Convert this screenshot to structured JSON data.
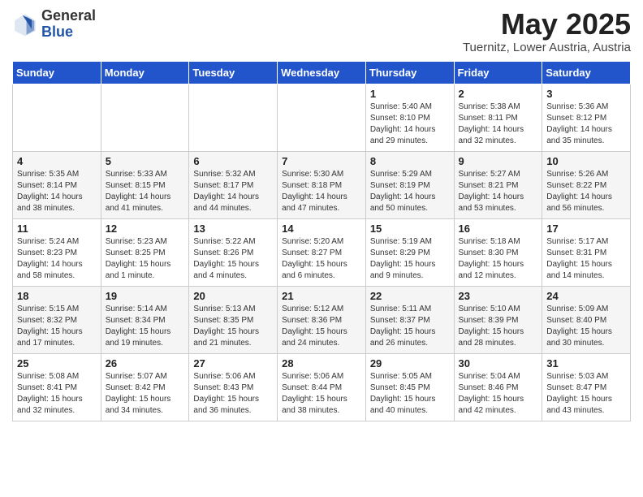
{
  "logo": {
    "general": "General",
    "blue": "Blue"
  },
  "title": "May 2025",
  "subtitle": "Tuernitz, Lower Austria, Austria",
  "days_header": [
    "Sunday",
    "Monday",
    "Tuesday",
    "Wednesday",
    "Thursday",
    "Friday",
    "Saturday"
  ],
  "weeks": [
    [
      {
        "num": "",
        "info": ""
      },
      {
        "num": "",
        "info": ""
      },
      {
        "num": "",
        "info": ""
      },
      {
        "num": "",
        "info": ""
      },
      {
        "num": "1",
        "info": "Sunrise: 5:40 AM\nSunset: 8:10 PM\nDaylight: 14 hours\nand 29 minutes."
      },
      {
        "num": "2",
        "info": "Sunrise: 5:38 AM\nSunset: 8:11 PM\nDaylight: 14 hours\nand 32 minutes."
      },
      {
        "num": "3",
        "info": "Sunrise: 5:36 AM\nSunset: 8:12 PM\nDaylight: 14 hours\nand 35 minutes."
      }
    ],
    [
      {
        "num": "4",
        "info": "Sunrise: 5:35 AM\nSunset: 8:14 PM\nDaylight: 14 hours\nand 38 minutes."
      },
      {
        "num": "5",
        "info": "Sunrise: 5:33 AM\nSunset: 8:15 PM\nDaylight: 14 hours\nand 41 minutes."
      },
      {
        "num": "6",
        "info": "Sunrise: 5:32 AM\nSunset: 8:17 PM\nDaylight: 14 hours\nand 44 minutes."
      },
      {
        "num": "7",
        "info": "Sunrise: 5:30 AM\nSunset: 8:18 PM\nDaylight: 14 hours\nand 47 minutes."
      },
      {
        "num": "8",
        "info": "Sunrise: 5:29 AM\nSunset: 8:19 PM\nDaylight: 14 hours\nand 50 minutes."
      },
      {
        "num": "9",
        "info": "Sunrise: 5:27 AM\nSunset: 8:21 PM\nDaylight: 14 hours\nand 53 minutes."
      },
      {
        "num": "10",
        "info": "Sunrise: 5:26 AM\nSunset: 8:22 PM\nDaylight: 14 hours\nand 56 minutes."
      }
    ],
    [
      {
        "num": "11",
        "info": "Sunrise: 5:24 AM\nSunset: 8:23 PM\nDaylight: 14 hours\nand 58 minutes."
      },
      {
        "num": "12",
        "info": "Sunrise: 5:23 AM\nSunset: 8:25 PM\nDaylight: 15 hours\nand 1 minute."
      },
      {
        "num": "13",
        "info": "Sunrise: 5:22 AM\nSunset: 8:26 PM\nDaylight: 15 hours\nand 4 minutes."
      },
      {
        "num": "14",
        "info": "Sunrise: 5:20 AM\nSunset: 8:27 PM\nDaylight: 15 hours\nand 6 minutes."
      },
      {
        "num": "15",
        "info": "Sunrise: 5:19 AM\nSunset: 8:29 PM\nDaylight: 15 hours\nand 9 minutes."
      },
      {
        "num": "16",
        "info": "Sunrise: 5:18 AM\nSunset: 8:30 PM\nDaylight: 15 hours\nand 12 minutes."
      },
      {
        "num": "17",
        "info": "Sunrise: 5:17 AM\nSunset: 8:31 PM\nDaylight: 15 hours\nand 14 minutes."
      }
    ],
    [
      {
        "num": "18",
        "info": "Sunrise: 5:15 AM\nSunset: 8:32 PM\nDaylight: 15 hours\nand 17 minutes."
      },
      {
        "num": "19",
        "info": "Sunrise: 5:14 AM\nSunset: 8:34 PM\nDaylight: 15 hours\nand 19 minutes."
      },
      {
        "num": "20",
        "info": "Sunrise: 5:13 AM\nSunset: 8:35 PM\nDaylight: 15 hours\nand 21 minutes."
      },
      {
        "num": "21",
        "info": "Sunrise: 5:12 AM\nSunset: 8:36 PM\nDaylight: 15 hours\nand 24 minutes."
      },
      {
        "num": "22",
        "info": "Sunrise: 5:11 AM\nSunset: 8:37 PM\nDaylight: 15 hours\nand 26 minutes."
      },
      {
        "num": "23",
        "info": "Sunrise: 5:10 AM\nSunset: 8:39 PM\nDaylight: 15 hours\nand 28 minutes."
      },
      {
        "num": "24",
        "info": "Sunrise: 5:09 AM\nSunset: 8:40 PM\nDaylight: 15 hours\nand 30 minutes."
      }
    ],
    [
      {
        "num": "25",
        "info": "Sunrise: 5:08 AM\nSunset: 8:41 PM\nDaylight: 15 hours\nand 32 minutes."
      },
      {
        "num": "26",
        "info": "Sunrise: 5:07 AM\nSunset: 8:42 PM\nDaylight: 15 hours\nand 34 minutes."
      },
      {
        "num": "27",
        "info": "Sunrise: 5:06 AM\nSunset: 8:43 PM\nDaylight: 15 hours\nand 36 minutes."
      },
      {
        "num": "28",
        "info": "Sunrise: 5:06 AM\nSunset: 8:44 PM\nDaylight: 15 hours\nand 38 minutes."
      },
      {
        "num": "29",
        "info": "Sunrise: 5:05 AM\nSunset: 8:45 PM\nDaylight: 15 hours\nand 40 minutes."
      },
      {
        "num": "30",
        "info": "Sunrise: 5:04 AM\nSunset: 8:46 PM\nDaylight: 15 hours\nand 42 minutes."
      },
      {
        "num": "31",
        "info": "Sunrise: 5:03 AM\nSunset: 8:47 PM\nDaylight: 15 hours\nand 43 minutes."
      }
    ]
  ]
}
